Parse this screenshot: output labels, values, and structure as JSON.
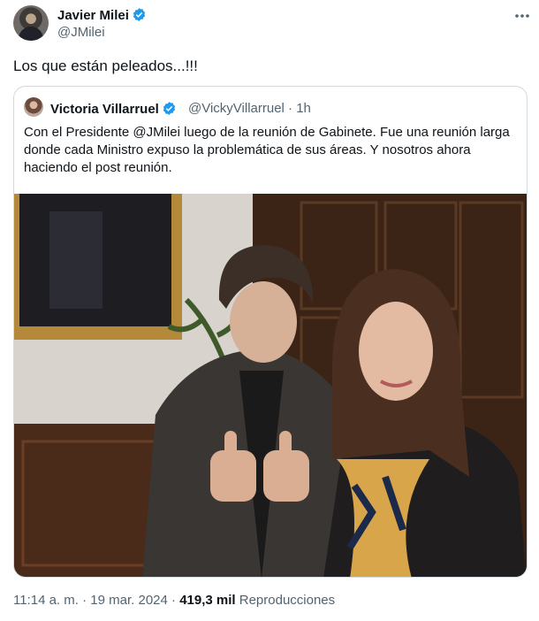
{
  "author": {
    "name": "Javier Milei",
    "handle": "@JMilei",
    "verified": true
  },
  "tweet": {
    "text": "Los que están peleados...!!!"
  },
  "quoted": {
    "name": "Victoria Villarruel",
    "handle": "@VickyVillarruel",
    "separator": "·",
    "time": "1h",
    "text": "Con el Presidente @JMilei luego de la reunión de Gabinete. Fue una reunión larga donde cada Ministro expuso la problemática de sus áreas. Y nosotros ahora haciendo el post reunión."
  },
  "footer": {
    "time": "11:14 a. m.",
    "dot": "·",
    "date": "19 mar. 2024",
    "dot2": "·",
    "views": "419,3 mil",
    "views_label": "Reproducciones"
  },
  "colors": {
    "verified": "#1d9bf0",
    "secondary_text": "#536471",
    "border": "#cfd9de"
  },
  "icons": [
    "verified-icon",
    "more-icon"
  ]
}
